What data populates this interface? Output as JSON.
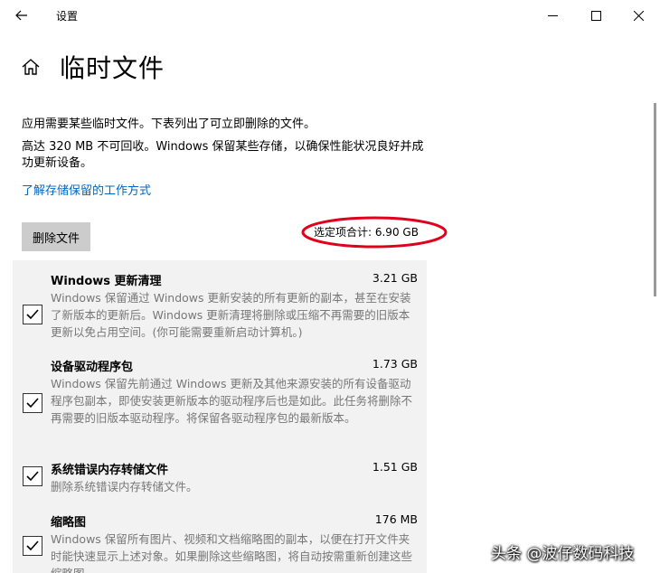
{
  "window": {
    "title": "设置"
  },
  "page": {
    "title": "临时文件",
    "description1": "应用需要某些临时文件。下表列出了可立即删除的文件。",
    "description2": "高达 320 MB 不可回收。Windows 保留某些存储，以确保性能状况良好并成功更新设备。",
    "learn_link": "了解存储保留的工作方式",
    "remove_button": "删除文件",
    "selected_total": "选定项合计: 6.90 GB"
  },
  "items": [
    {
      "name": "Windows 更新清理",
      "size": "3.21 GB",
      "checked": true,
      "description": "Windows 保留通过 Windows 更新安装的所有更新的副本，甚至在安装了新版本的更新后。Windows 更新清理将删除或压缩不再需要的旧版本更新以免占用空间。(你可能需要重新启动计算机。)"
    },
    {
      "name": "设备驱动程序包",
      "size": "1.73 GB",
      "checked": true,
      "description": "Windows 保留先前通过 Windows 更新及其他来源安装的所有设备驱动程序包副本，即使安装更新版本的驱动程序后也是如此。此任务将删除不再需要的旧版本驱动程序。将保留各驱动程序包的最新版本。"
    },
    {
      "name": "系统错误内存转储文件",
      "size": "1.51 GB",
      "checked": true,
      "description": "删除系统错误内存转储文件。"
    },
    {
      "name": "缩略图",
      "size": "176 MB",
      "checked": true,
      "description": "Windows 保留所有图片、视频和文档缩略图的副本，以便在打开文件夹时能快速显示上述对象。如果删除这些缩略图，将自动按需重新创建这些缩略图。"
    }
  ],
  "watermark": "头条 @波仔数码科技",
  "colors": {
    "link": "#0067c0",
    "button_bg": "#cccccc",
    "list_bg": "#f2f2f2",
    "annotation": "#e0001b"
  },
  "icons": [
    "back-arrow-icon",
    "minimize-icon",
    "maximize-icon",
    "close-icon",
    "home-icon",
    "checkmark-icon"
  ]
}
